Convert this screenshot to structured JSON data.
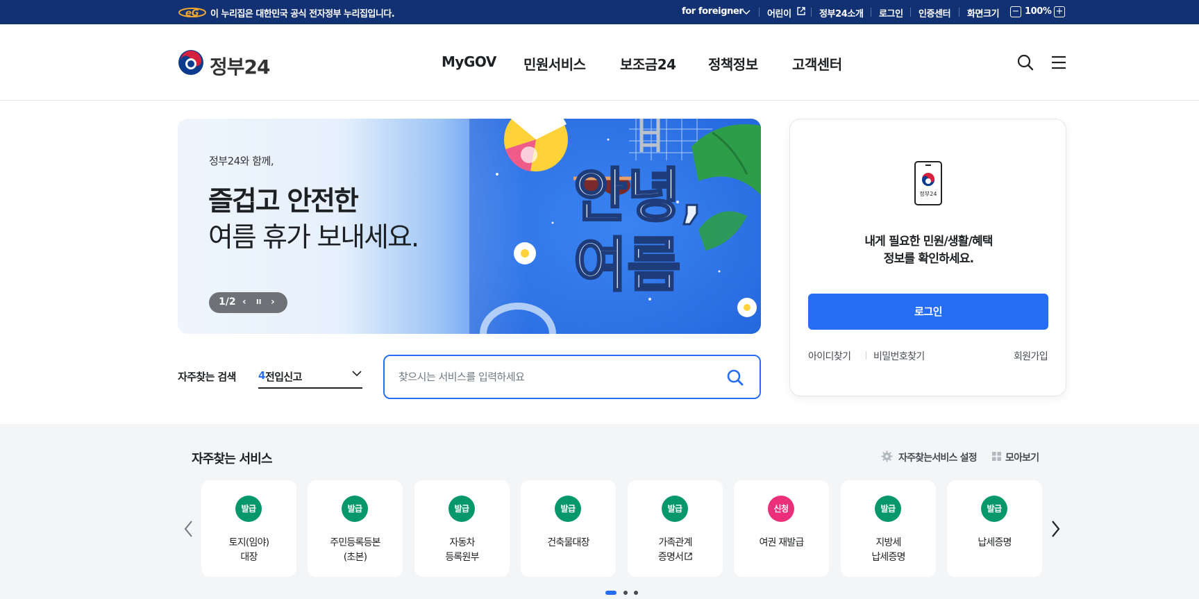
{
  "topbar": {
    "notice": "이 누리집은 대한민국 공식 전자정부 누리집입니다.",
    "foreigner": "for foreigner",
    "kids": "어린이",
    "about": "정부24소개",
    "login": "로그인",
    "cert": "인증센터",
    "screen_size": "화면크기",
    "zoom_out": "−",
    "zoom": "100%",
    "zoom_in": "+"
  },
  "header": {
    "logo_text": "정부24",
    "nav": [
      "MyGOV",
      "민원서비스",
      "보조금24",
      "정책정보",
      "고객센터"
    ]
  },
  "banner": {
    "subtitle": "정부24와 함께,",
    "headline_bold": "즐겁고 안전한",
    "headline_regular": "여름 휴가 보내세요.",
    "art_text_1": "안녕,",
    "art_text_2": "여름",
    "counter": "1/2",
    "prev": "‹",
    "pause": "II",
    "next": "›"
  },
  "login_card": {
    "phone_label": "정부24",
    "message_line1": "내게 필요한 민원/생활/혜택",
    "message_line2": "정보를 확인하세요.",
    "login_button": "로그인",
    "find_id": "아이디찾기",
    "find_password": "비밀번호찾기",
    "signup": "회원가입"
  },
  "search": {
    "frequent_label": "자주찾는 검색",
    "frequent_rank": "4",
    "frequent_value": "전입신고",
    "placeholder": "찾으시는 서비스를 입력하세요"
  },
  "services": {
    "title": "자주찾는 서비스",
    "settings": "자주찾는서비스 설정",
    "view_all": "모아보기",
    "cards": [
      {
        "badge": "발급",
        "line1": "토지(임야)",
        "line2": "대장"
      },
      {
        "badge": "발급",
        "line1": "주민등록등본",
        "line2": "(초본)"
      },
      {
        "badge": "발급",
        "line1": "자동차",
        "line2": "등록원부"
      },
      {
        "badge": "발급",
        "line1": "건축물대장",
        "line2": ""
      },
      {
        "badge": "발급",
        "line1": "가족관계",
        "line2": "증명서"
      },
      {
        "badge": "신청",
        "line1": "여권 재발급",
        "line2": ""
      },
      {
        "badge": "발급",
        "line1": "지방세",
        "line2": "납세증명"
      },
      {
        "badge": "발급",
        "line1": "납세증명",
        "line2": ""
      }
    ]
  },
  "colors": {
    "topbar_bg": "#123172",
    "primary": "#256ef4",
    "badge_issue": "#06986b",
    "badge_apply": "#ec2f7a",
    "services_bg": "#f4f5f6"
  }
}
